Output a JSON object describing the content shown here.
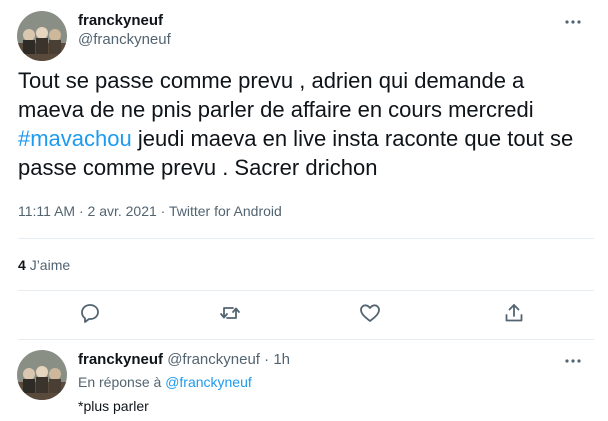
{
  "tweet": {
    "author_name": "franckyneuf",
    "author_handle": "@franckyneuf",
    "text_part1": "Tout se passe comme prevu , adrien qui demande a maeva de ne pnis parler de affaire en cours mercredi ",
    "hashtag": "#mavachou",
    "text_part2": " jeudi maeva en live insta raconte que tout se passe comme prevu . Sacrer drichon",
    "timestamp": "11:11 AM · 2 avr. 2021 · Twitter for Android",
    "likes_count": "4",
    "likes_label": "J’aime"
  },
  "actions": {
    "reply_icon": "reply-icon",
    "retweet_icon": "retweet-icon",
    "like_icon": "heart-icon",
    "share_icon": "share-icon"
  },
  "reply": {
    "author_name": "franckyneuf",
    "author_handle": "@franckyneuf",
    "age": "· 1h",
    "in_reply_to_prefix": "En réponse à",
    "in_reply_to_handle": "@franckyneuf",
    "text": "*plus parler"
  },
  "colors": {
    "link": "#1d9bf0",
    "secondary_text": "#536471",
    "primary_text": "#0f1419",
    "divider": "#e6ecf0"
  }
}
